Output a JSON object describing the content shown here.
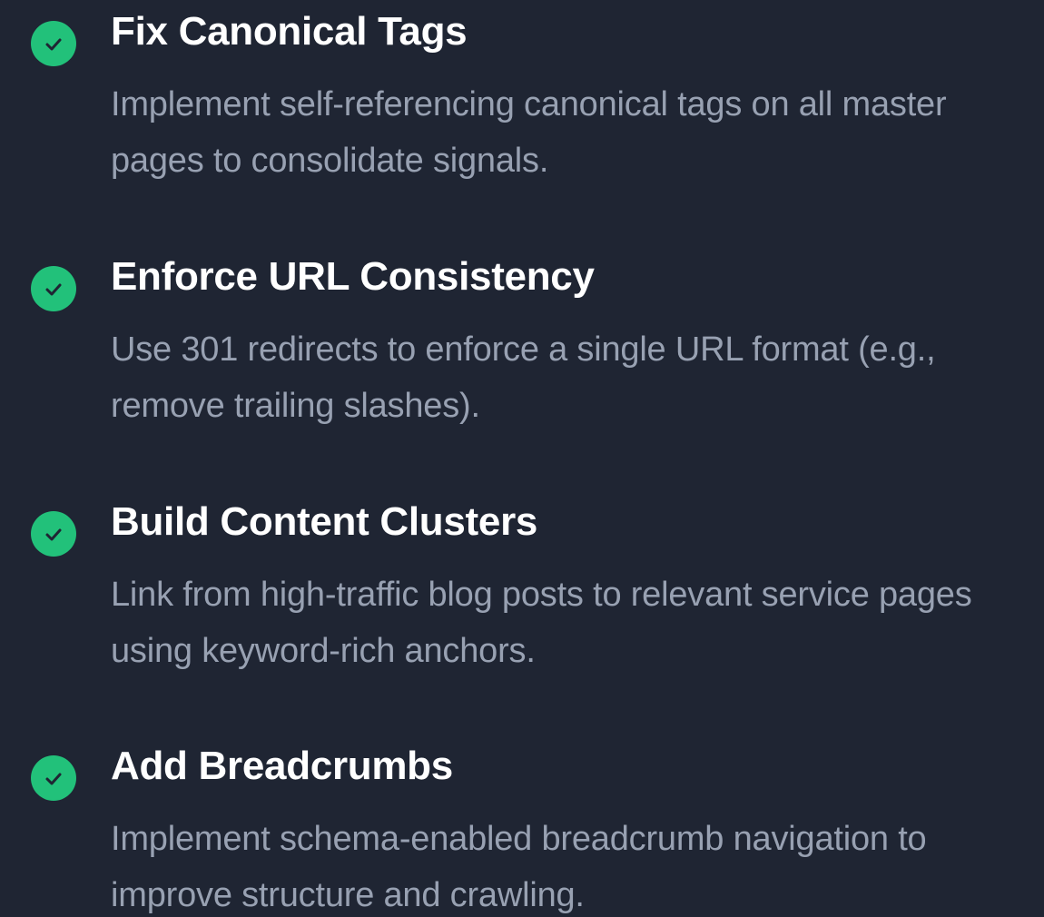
{
  "checklist": {
    "accent_color": "#22c17a",
    "icon": "check-circle-icon",
    "items": [
      {
        "title": "Fix Canonical Tags",
        "description": "Implement self-referencing canonical tags on all master pages to consolidate signals."
      },
      {
        "title": "Enforce URL Consistency",
        "description": "Use 301 redirects to enforce a single URL format (e.g., remove trailing slashes)."
      },
      {
        "title": "Build Content Clusters",
        "description": "Link from high-traffic blog posts to relevant service pages using keyword-rich anchors."
      },
      {
        "title": "Add Breadcrumbs",
        "description": "Implement schema-enabled breadcrumb navigation to improve structure and crawling."
      }
    ]
  }
}
